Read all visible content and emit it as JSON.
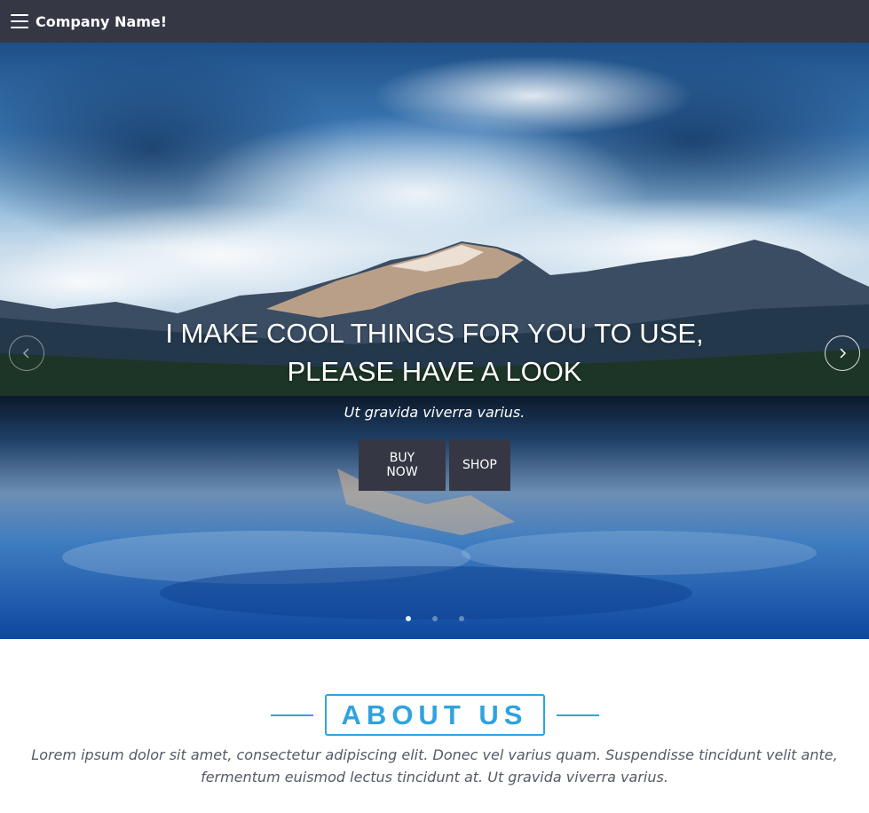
{
  "navbar": {
    "brand": "Company Name!",
    "menu_icon": "hamburger-icon",
    "background": "#353844"
  },
  "hero": {
    "title_line1": "I MAKE COOL THINGS FOR YOU TO USE,",
    "title_line2": "PLEASE HAVE A LOOK",
    "subtitle": "Ut gravida viverra varius.",
    "buttons": [
      {
        "label": "BUY NOW"
      },
      {
        "label": "SHOP"
      }
    ],
    "prev_icon": "chevron-left-icon",
    "next_icon": "chevron-right-icon",
    "slides_count": 3,
    "active_slide": 1
  },
  "about": {
    "title": "ABOUT US",
    "text": "Lorem ipsum dolor sit amet, consectetur adipiscing elit. Donec vel varius quam. Suspendisse tincidunt velit ante, fermentum euismod lectus tincidunt at. Ut gravida viverra varius.",
    "accent": "#2fa3df"
  }
}
